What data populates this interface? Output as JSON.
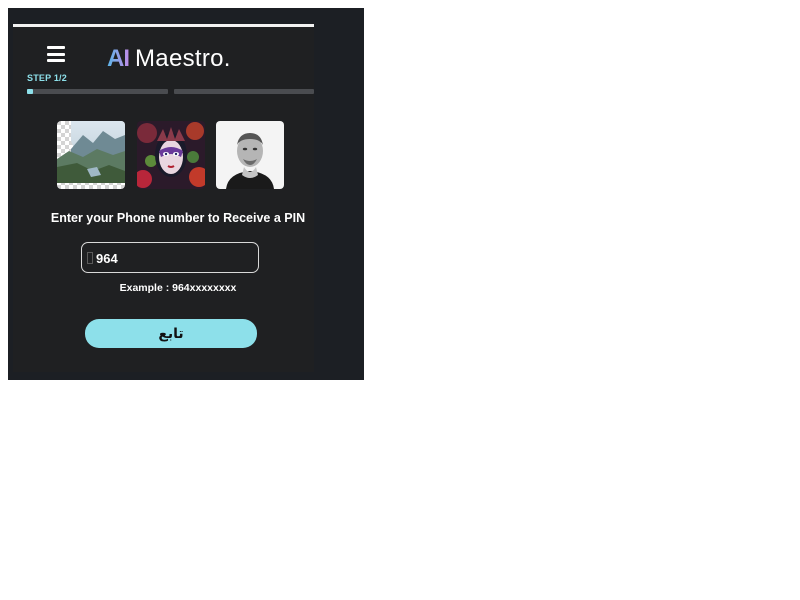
{
  "header": {
    "menu_icon": "hamburger-menu-icon",
    "logo_mark": "AI",
    "logo_text": "Maestro.",
    "logo_gradient": [
      "#5ab6e8",
      "#c08ce8"
    ]
  },
  "progress": {
    "step_label": "STEP 1/2",
    "segments": [
      {
        "fill_fraction": 0.04
      },
      {
        "fill_fraction": 0
      }
    ],
    "accent_color": "#8de0ea"
  },
  "thumbnails": [
    {
      "subject": "mountain-landscape-transparent-background"
    },
    {
      "subject": "fantasy-masked-woman-portrait"
    },
    {
      "subject": "bald-man-black-and-white-portrait"
    }
  ],
  "form": {
    "heading": "Enter your Phone number to Receive a PIN",
    "phone_value": "964",
    "example_text": "Example : 964xxxxxxxx",
    "submit_label": "تابع"
  },
  "colors": {
    "background": "#1f2022",
    "accent": "#8de0ea",
    "text": "#ffffff"
  }
}
